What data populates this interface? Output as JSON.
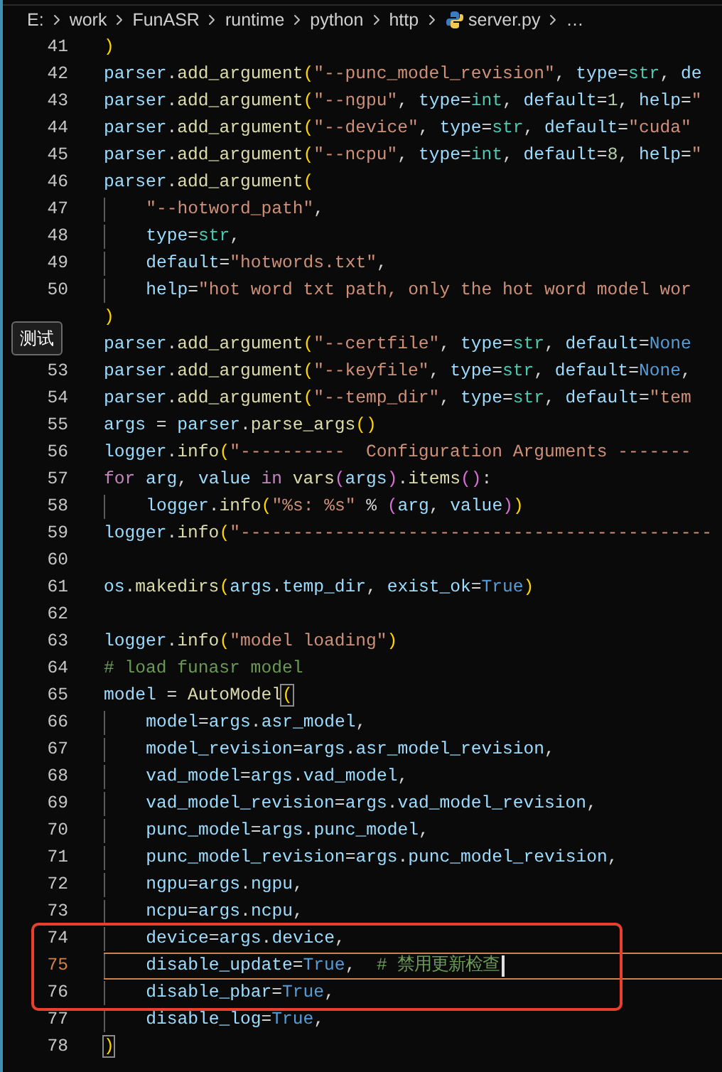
{
  "breadcrumb": [
    {
      "text": "E:",
      "kind": "folder"
    },
    {
      "text": "work",
      "kind": "folder"
    },
    {
      "text": "FunASR",
      "kind": "folder"
    },
    {
      "text": "runtime",
      "kind": "folder"
    },
    {
      "text": "python",
      "kind": "folder"
    },
    {
      "text": "http",
      "kind": "folder"
    },
    {
      "text": "server.py",
      "kind": "python-file"
    },
    {
      "text": "…",
      "kind": "more"
    }
  ],
  "tooltip": {
    "text": "测试"
  },
  "lines": [
    {
      "number": "41",
      "selected": false,
      "boxed": false,
      "tokens": [
        {
          "kind": "br1",
          "text": ")"
        }
      ]
    },
    {
      "number": "42",
      "selected": false,
      "boxed": false,
      "tokens": [
        {
          "kind": "var",
          "text": "parser"
        },
        {
          "kind": "p",
          "text": "."
        },
        {
          "kind": "fn",
          "text": "add_argument"
        },
        {
          "kind": "br1",
          "text": "("
        },
        {
          "kind": "str",
          "text": "\"--punc_model_revision\""
        },
        {
          "kind": "p",
          "text": ", "
        },
        {
          "kind": "var",
          "text": "type"
        },
        {
          "kind": "p",
          "text": "="
        },
        {
          "kind": "type",
          "text": "str"
        },
        {
          "kind": "p",
          "text": ", "
        },
        {
          "kind": "var",
          "text": "de"
        }
      ]
    },
    {
      "number": "43",
      "selected": false,
      "boxed": false,
      "tokens": [
        {
          "kind": "var",
          "text": "parser"
        },
        {
          "kind": "p",
          "text": "."
        },
        {
          "kind": "fn",
          "text": "add_argument"
        },
        {
          "kind": "br1",
          "text": "("
        },
        {
          "kind": "str",
          "text": "\"--ngpu\""
        },
        {
          "kind": "p",
          "text": ", "
        },
        {
          "kind": "var",
          "text": "type"
        },
        {
          "kind": "p",
          "text": "="
        },
        {
          "kind": "type",
          "text": "int"
        },
        {
          "kind": "p",
          "text": ", "
        },
        {
          "kind": "var",
          "text": "default"
        },
        {
          "kind": "p",
          "text": "="
        },
        {
          "kind": "num",
          "text": "1"
        },
        {
          "kind": "p",
          "text": ", "
        },
        {
          "kind": "var",
          "text": "help"
        },
        {
          "kind": "p",
          "text": "="
        },
        {
          "kind": "str",
          "text": "\""
        }
      ]
    },
    {
      "number": "44",
      "selected": false,
      "boxed": false,
      "tokens": [
        {
          "kind": "var",
          "text": "parser"
        },
        {
          "kind": "p",
          "text": "."
        },
        {
          "kind": "fn",
          "text": "add_argument"
        },
        {
          "kind": "br1",
          "text": "("
        },
        {
          "kind": "str",
          "text": "\"--device\""
        },
        {
          "kind": "p",
          "text": ", "
        },
        {
          "kind": "var",
          "text": "type"
        },
        {
          "kind": "p",
          "text": "="
        },
        {
          "kind": "type",
          "text": "str"
        },
        {
          "kind": "p",
          "text": ", "
        },
        {
          "kind": "var",
          "text": "default"
        },
        {
          "kind": "p",
          "text": "="
        },
        {
          "kind": "str",
          "text": "\"cuda\""
        }
      ]
    },
    {
      "number": "45",
      "selected": false,
      "boxed": false,
      "tokens": [
        {
          "kind": "var",
          "text": "parser"
        },
        {
          "kind": "p",
          "text": "."
        },
        {
          "kind": "fn",
          "text": "add_argument"
        },
        {
          "kind": "br1",
          "text": "("
        },
        {
          "kind": "str",
          "text": "\"--ncpu\""
        },
        {
          "kind": "p",
          "text": ", "
        },
        {
          "kind": "var",
          "text": "type"
        },
        {
          "kind": "p",
          "text": "="
        },
        {
          "kind": "type",
          "text": "int"
        },
        {
          "kind": "p",
          "text": ", "
        },
        {
          "kind": "var",
          "text": "default"
        },
        {
          "kind": "p",
          "text": "="
        },
        {
          "kind": "num",
          "text": "8"
        },
        {
          "kind": "p",
          "text": ", "
        },
        {
          "kind": "var",
          "text": "help"
        },
        {
          "kind": "p",
          "text": "="
        },
        {
          "kind": "str",
          "text": "\""
        }
      ]
    },
    {
      "number": "46",
      "selected": false,
      "boxed": false,
      "tokens": [
        {
          "kind": "var",
          "text": "parser"
        },
        {
          "kind": "p",
          "text": "."
        },
        {
          "kind": "fn",
          "text": "add_argument"
        },
        {
          "kind": "br1",
          "text": "("
        }
      ],
      "children": [
        {
          "number": "47",
          "selected": false,
          "boxed": false,
          "tokens": [
            {
              "kind": "str",
              "text": "\"--hotword_path\""
            },
            {
              "kind": "p",
              "text": ","
            }
          ]
        },
        {
          "number": "48",
          "selected": false,
          "boxed": false,
          "tokens": [
            {
              "kind": "var",
              "text": "type"
            },
            {
              "kind": "p",
              "text": "="
            },
            {
              "kind": "type",
              "text": "str"
            },
            {
              "kind": "p",
              "text": ","
            }
          ]
        },
        {
          "number": "49",
          "selected": false,
          "boxed": false,
          "tokens": [
            {
              "kind": "var",
              "text": "default"
            },
            {
              "kind": "p",
              "text": "="
            },
            {
              "kind": "str",
              "text": "\"hotwords.txt\""
            },
            {
              "kind": "p",
              "text": ","
            }
          ]
        },
        {
          "number": "50",
          "selected": false,
          "boxed": false,
          "tokens": [
            {
              "kind": "var",
              "text": "help"
            },
            {
              "kind": "p",
              "text": "="
            },
            {
              "kind": "str",
              "text": "\"hot word txt path, only the hot word model wor"
            }
          ]
        }
      ]
    },
    {
      "selected": false,
      "boxed": false,
      "tokens": [
        {
          "kind": "br1",
          "text": ")"
        }
      ]
    },
    {
      "selected": false,
      "boxed": false,
      "tokens": [
        {
          "kind": "var",
          "text": "parser"
        },
        {
          "kind": "p",
          "text": "."
        },
        {
          "kind": "fn",
          "text": "add_argument"
        },
        {
          "kind": "br1",
          "text": "("
        },
        {
          "kind": "str",
          "text": "\"--certfile\""
        },
        {
          "kind": "p",
          "text": ", "
        },
        {
          "kind": "var",
          "text": "type"
        },
        {
          "kind": "p",
          "text": "="
        },
        {
          "kind": "type",
          "text": "str"
        },
        {
          "kind": "p",
          "text": ", "
        },
        {
          "kind": "var",
          "text": "default"
        },
        {
          "kind": "p",
          "text": "="
        },
        {
          "kind": "const",
          "text": "None"
        }
      ]
    },
    {
      "number": "53",
      "selected": false,
      "boxed": false,
      "tokens": [
        {
          "kind": "var",
          "text": "parser"
        },
        {
          "kind": "p",
          "text": "."
        },
        {
          "kind": "fn",
          "text": "add_argument"
        },
        {
          "kind": "br1",
          "text": "("
        },
        {
          "kind": "str",
          "text": "\"--keyfile\""
        },
        {
          "kind": "p",
          "text": ", "
        },
        {
          "kind": "var",
          "text": "type"
        },
        {
          "kind": "p",
          "text": "="
        },
        {
          "kind": "type",
          "text": "str"
        },
        {
          "kind": "p",
          "text": ", "
        },
        {
          "kind": "var",
          "text": "default"
        },
        {
          "kind": "p",
          "text": "="
        },
        {
          "kind": "const",
          "text": "None"
        },
        {
          "kind": "p",
          "text": ","
        }
      ]
    },
    {
      "number": "54",
      "selected": false,
      "boxed": false,
      "tokens": [
        {
          "kind": "var",
          "text": "parser"
        },
        {
          "kind": "p",
          "text": "."
        },
        {
          "kind": "fn",
          "text": "add_argument"
        },
        {
          "kind": "br1",
          "text": "("
        },
        {
          "kind": "str",
          "text": "\"--temp_dir\""
        },
        {
          "kind": "p",
          "text": ", "
        },
        {
          "kind": "var",
          "text": "type"
        },
        {
          "kind": "p",
          "text": "="
        },
        {
          "kind": "type",
          "text": "str"
        },
        {
          "kind": "p",
          "text": ", "
        },
        {
          "kind": "var",
          "text": "default"
        },
        {
          "kind": "p",
          "text": "="
        },
        {
          "kind": "str",
          "text": "\"tem"
        }
      ]
    },
    {
      "number": "55",
      "selected": false,
      "boxed": false,
      "tokens": [
        {
          "kind": "var",
          "text": "args"
        },
        {
          "kind": "p",
          "text": " = "
        },
        {
          "kind": "var",
          "text": "parser"
        },
        {
          "kind": "p",
          "text": "."
        },
        {
          "kind": "fn",
          "text": "parse_args"
        },
        {
          "kind": "br1",
          "text": "()"
        }
      ]
    },
    {
      "number": "56",
      "selected": false,
      "boxed": false,
      "tokens": [
        {
          "kind": "var",
          "text": "logger"
        },
        {
          "kind": "p",
          "text": "."
        },
        {
          "kind": "fn",
          "text": "info"
        },
        {
          "kind": "br1",
          "text": "("
        },
        {
          "kind": "str",
          "text": "\"----------  Configuration Arguments -------"
        }
      ]
    },
    {
      "number": "57",
      "selected": false,
      "boxed": false,
      "tokens": [
        {
          "kind": "kw",
          "text": "for"
        },
        {
          "kind": "var",
          "text": " arg"
        },
        {
          "kind": "p",
          "text": ", "
        },
        {
          "kind": "var",
          "text": "value"
        },
        {
          "kind": "kw",
          "text": " in"
        },
        {
          "kind": "fn",
          "text": " vars"
        },
        {
          "kind": "br2",
          "text": "("
        },
        {
          "kind": "var",
          "text": "args"
        },
        {
          "kind": "br2",
          "text": ")"
        },
        {
          "kind": "p",
          "text": "."
        },
        {
          "kind": "fn",
          "text": "items"
        },
        {
          "kind": "br2",
          "text": "()"
        },
        {
          "kind": "p",
          "text": ":"
        }
      ],
      "children": [
        {
          "number": "58",
          "selected": false,
          "boxed": false,
          "tokens": [
            {
              "kind": "var",
              "text": "logger"
            },
            {
              "kind": "p",
              "text": "."
            },
            {
              "kind": "fn",
              "text": "info"
            },
            {
              "kind": "br1",
              "text": "("
            },
            {
              "kind": "str",
              "text": "\"%s: %s\""
            },
            {
              "kind": "p",
              "text": " % "
            },
            {
              "kind": "br2",
              "text": "("
            },
            {
              "kind": "var",
              "text": "arg"
            },
            {
              "kind": "p",
              "text": ", "
            },
            {
              "kind": "var",
              "text": "value"
            },
            {
              "kind": "br2",
              "text": ")"
            },
            {
              "kind": "br1",
              "text": ")"
            }
          ]
        }
      ]
    },
    {
      "number": "59",
      "selected": false,
      "boxed": false,
      "tokens": [
        {
          "kind": "var",
          "text": "logger"
        },
        {
          "kind": "p",
          "text": "."
        },
        {
          "kind": "fn",
          "text": "info"
        },
        {
          "kind": "br1",
          "text": "("
        },
        {
          "kind": "str",
          "text": "\"---------------------------------------------"
        }
      ]
    },
    {
      "number": "60",
      "selected": false,
      "boxed": false
    },
    {
      "number": "61",
      "selected": false,
      "boxed": false,
      "tokens": [
        {
          "kind": "var",
          "text": "os"
        },
        {
          "kind": "p",
          "text": "."
        },
        {
          "kind": "fn",
          "text": "makedirs"
        },
        {
          "kind": "br1",
          "text": "("
        },
        {
          "kind": "var",
          "text": "args"
        },
        {
          "kind": "p",
          "text": "."
        },
        {
          "kind": "var",
          "text": "temp_dir"
        },
        {
          "kind": "p",
          "text": ", "
        },
        {
          "kind": "var",
          "text": "exist_ok"
        },
        {
          "kind": "p",
          "text": "="
        },
        {
          "kind": "const",
          "text": "True"
        },
        {
          "kind": "br1",
          "text": ")"
        }
      ]
    },
    {
      "number": "62",
      "selected": false,
      "boxed": false
    },
    {
      "number": "63",
      "selected": false,
      "boxed": false,
      "tokens": [
        {
          "kind": "var",
          "text": "logger"
        },
        {
          "kind": "p",
          "text": "."
        },
        {
          "kind": "fn",
          "text": "info"
        },
        {
          "kind": "br1",
          "text": "("
        },
        {
          "kind": "str",
          "text": "\"model loading\""
        },
        {
          "kind": "br1",
          "text": ")"
        }
      ]
    },
    {
      "number": "64",
      "selected": false,
      "boxed": false,
      "tokens": [
        {
          "kind": "cmt",
          "text": "# load funasr model"
        }
      ]
    },
    {
      "number": "65",
      "selected": false,
      "boxed": false,
      "tokens": [
        {
          "kind": "var",
          "text": "model"
        },
        {
          "kind": "p",
          "text": " = "
        },
        {
          "kind": "fn",
          "text": "AutoModel"
        },
        {
          "kind": "brm",
          "text": "("
        }
      ],
      "children": [
        {
          "number": "66",
          "selected": false,
          "boxed": false,
          "tokens": [
            {
              "kind": "var",
              "text": "model"
            },
            {
              "kind": "p",
              "text": "="
            },
            {
              "kind": "var",
              "text": "args"
            },
            {
              "kind": "p",
              "text": "."
            },
            {
              "kind": "var",
              "text": "asr_model"
            },
            {
              "kind": "p",
              "text": ","
            }
          ]
        },
        {
          "number": "67",
          "selected": false,
          "boxed": false,
          "tokens": [
            {
              "kind": "var",
              "text": "model_revision"
            },
            {
              "kind": "p",
              "text": "="
            },
            {
              "kind": "var",
              "text": "args"
            },
            {
              "kind": "p",
              "text": "."
            },
            {
              "kind": "var",
              "text": "asr_model_revision"
            },
            {
              "kind": "p",
              "text": ","
            }
          ]
        },
        {
          "number": "68",
          "selected": false,
          "boxed": false,
          "tokens": [
            {
              "kind": "var",
              "text": "vad_model"
            },
            {
              "kind": "p",
              "text": "="
            },
            {
              "kind": "var",
              "text": "args"
            },
            {
              "kind": "p",
              "text": "."
            },
            {
              "kind": "var",
              "text": "vad_model"
            },
            {
              "kind": "p",
              "text": ","
            }
          ]
        },
        {
          "number": "69",
          "selected": false,
          "boxed": false,
          "tokens": [
            {
              "kind": "var",
              "text": "vad_model_revision"
            },
            {
              "kind": "p",
              "text": "="
            },
            {
              "kind": "var",
              "text": "args"
            },
            {
              "kind": "p",
              "text": "."
            },
            {
              "kind": "var",
              "text": "vad_model_revision"
            },
            {
              "kind": "p",
              "text": ","
            }
          ]
        },
        {
          "number": "70",
          "selected": false,
          "boxed": false,
          "tokens": [
            {
              "kind": "var",
              "text": "punc_model"
            },
            {
              "kind": "p",
              "text": "="
            },
            {
              "kind": "var",
              "text": "args"
            },
            {
              "kind": "p",
              "text": "."
            },
            {
              "kind": "var",
              "text": "punc_model"
            },
            {
              "kind": "p",
              "text": ","
            }
          ]
        },
        {
          "number": "71",
          "selected": false,
          "boxed": false,
          "tokens": [
            {
              "kind": "var",
              "text": "punc_model_revision"
            },
            {
              "kind": "p",
              "text": "="
            },
            {
              "kind": "var",
              "text": "args"
            },
            {
              "kind": "p",
              "text": "."
            },
            {
              "kind": "var",
              "text": "punc_model_revision"
            },
            {
              "kind": "p",
              "text": ","
            }
          ]
        },
        {
          "number": "72",
          "selected": false,
          "boxed": false,
          "tokens": [
            {
              "kind": "var",
              "text": "ngpu"
            },
            {
              "kind": "p",
              "text": "="
            },
            {
              "kind": "var",
              "text": "args"
            },
            {
              "kind": "p",
              "text": "."
            },
            {
              "kind": "var",
              "text": "ngpu"
            },
            {
              "kind": "p",
              "text": ","
            }
          ]
        },
        {
          "number": "73",
          "selected": false,
          "boxed": false,
          "tokens": [
            {
              "kind": "var",
              "text": "ncpu"
            },
            {
              "kind": "p",
              "text": "="
            },
            {
              "kind": "var",
              "text": "args"
            },
            {
              "kind": "p",
              "text": "."
            },
            {
              "kind": "var",
              "text": "ncpu"
            },
            {
              "kind": "p",
              "text": ","
            }
          ]
        },
        {
          "number": "74",
          "selected": false,
          "boxed": true,
          "tokens": [
            {
              "kind": "var",
              "text": "device"
            },
            {
              "kind": "p",
              "text": "="
            },
            {
              "kind": "var",
              "text": "args"
            },
            {
              "kind": "p",
              "text": "."
            },
            {
              "kind": "var",
              "text": "device"
            },
            {
              "kind": "p",
              "text": ","
            }
          ]
        },
        {
          "number": "75",
          "selected": true,
          "boxed": true,
          "tokens": [
            {
              "kind": "var",
              "text": "disable_update"
            },
            {
              "kind": "p",
              "text": "="
            },
            {
              "kind": "const",
              "text": "True"
            },
            {
              "kind": "p",
              "text": ",  "
            },
            {
              "kind": "cmt",
              "text": "# 禁用更新检查"
            }
          ]
        },
        {
          "number": "76",
          "selected": false,
          "boxed": true,
          "tokens": [
            {
              "kind": "var",
              "text": "disable_pbar"
            },
            {
              "kind": "p",
              "text": "="
            },
            {
              "kind": "const",
              "text": "True"
            },
            {
              "kind": "p",
              "text": ","
            }
          ]
        },
        {
          "number": "77",
          "selected": false,
          "boxed": false,
          "tokens": [
            {
              "kind": "var",
              "text": "disable_log"
            },
            {
              "kind": "p",
              "text": "="
            },
            {
              "kind": "const",
              "text": "True"
            },
            {
              "kind": "p",
              "text": ","
            }
          ]
        }
      ]
    },
    {
      "number": "78",
      "selected": false,
      "boxed": false,
      "tokens": [
        {
          "kind": "brm",
          "text": ")"
        }
      ]
    }
  ]
}
